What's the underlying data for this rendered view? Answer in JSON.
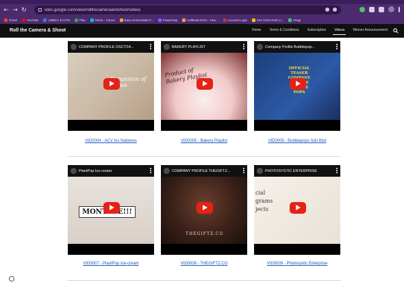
{
  "browser": {
    "url": "sites.google.com/view/rollthecameraandshoot/videos",
    "bookmarks": [
      {
        "label": "Gmail",
        "color": "#ea4335"
      },
      {
        "label": "YouTube",
        "color": "#ff0000"
      },
      {
        "label": "UMMA | E-UTM",
        "color": "#3f7fd6"
      },
      {
        "label": "Play",
        "color": "#34a853"
      },
      {
        "label": "Home - Canva",
        "color": "#00c4cc"
      },
      {
        "label": "Easy Homemade P...",
        "color": "#f5a623"
      },
      {
        "label": "Powermap",
        "color": "#7b61ff"
      },
      {
        "label": "Calibrate Ezee - Hea...",
        "color": "#e8a33d"
      },
      {
        "label": "Account Login",
        "color": "#c0392b"
      },
      {
        "label": "Fee Gunn Park Li...",
        "color": "#f1c40f"
      },
      {
        "label": "Imagi",
        "color": "#2ecc71"
      }
    ]
  },
  "site": {
    "title": "Roll the Camera & Shoot",
    "nav": [
      {
        "label": "Home",
        "active": false
      },
      {
        "label": "Terms & Conditions",
        "active": false
      },
      {
        "label": "Subscription",
        "active": false
      },
      {
        "label": "Videos",
        "active": true
      },
      {
        "label": "Winner Announcement",
        "active": false
      }
    ]
  },
  "videos": [
    {
      "title": "COMPANY PROFILE OSCTS4...",
      "caption": "VID0004 - ACV Ins Nationes",
      "overlay": "Expansion of brows",
      "thumb_bg": "linear-gradient(135deg,#d9cdbd 0%,#c9b8a4 55%,#b79e86 100%)"
    },
    {
      "title": "BAKERY PLAYLIST",
      "caption": "VID0005 - Bakery Playlist",
      "overlay": "Product of Bakery Playlist",
      "thumb_bg": "radial-gradient(circle at 50% 70%,#fbeeee 0%,#f2c9c9 45%,#7a2f2f 100%)"
    },
    {
      "title": "Company Profile Bubblepop...",
      "caption": "VID0006 - Bubblepops Sdn Bhd",
      "overlay": "OFFICIAL TEASER COMPANY PROFILE BUBBLE POPS",
      "thumb_bg": "linear-gradient(135deg,#1d3f7a 0%,#2c5aa6 60%,#1a2f5e 100%)"
    },
    {
      "title": "PlantPop Ice-cream",
      "caption": "VID0007 - PlantPop Ice-cream",
      "overlay": "MONTAGE!!!",
      "thumb_bg": "linear-gradient(180deg,#e8e2dc 0%,#d8cfc8 100%)"
    },
    {
      "title": "COMPANY PROFILE THEGIFTZ...",
      "caption": "VID0008 - THEGIFTZ.CO",
      "overlay": "THEGIFTZ.CO",
      "thumb_bg": "radial-gradient(circle at 50% 40%,#6b3f2e 0%,#3a2119 55%,#1a0f0b 100%)"
    },
    {
      "title": "PHOTOSYSTIC ENTERPRISE",
      "caption": "VID0009 - Photosystic Enterprise",
      "overlay": "cial grams jects",
      "thumb_bg": "linear-gradient(135deg,#f5f0ea 0%,#e9e1d6 100%)"
    }
  ]
}
